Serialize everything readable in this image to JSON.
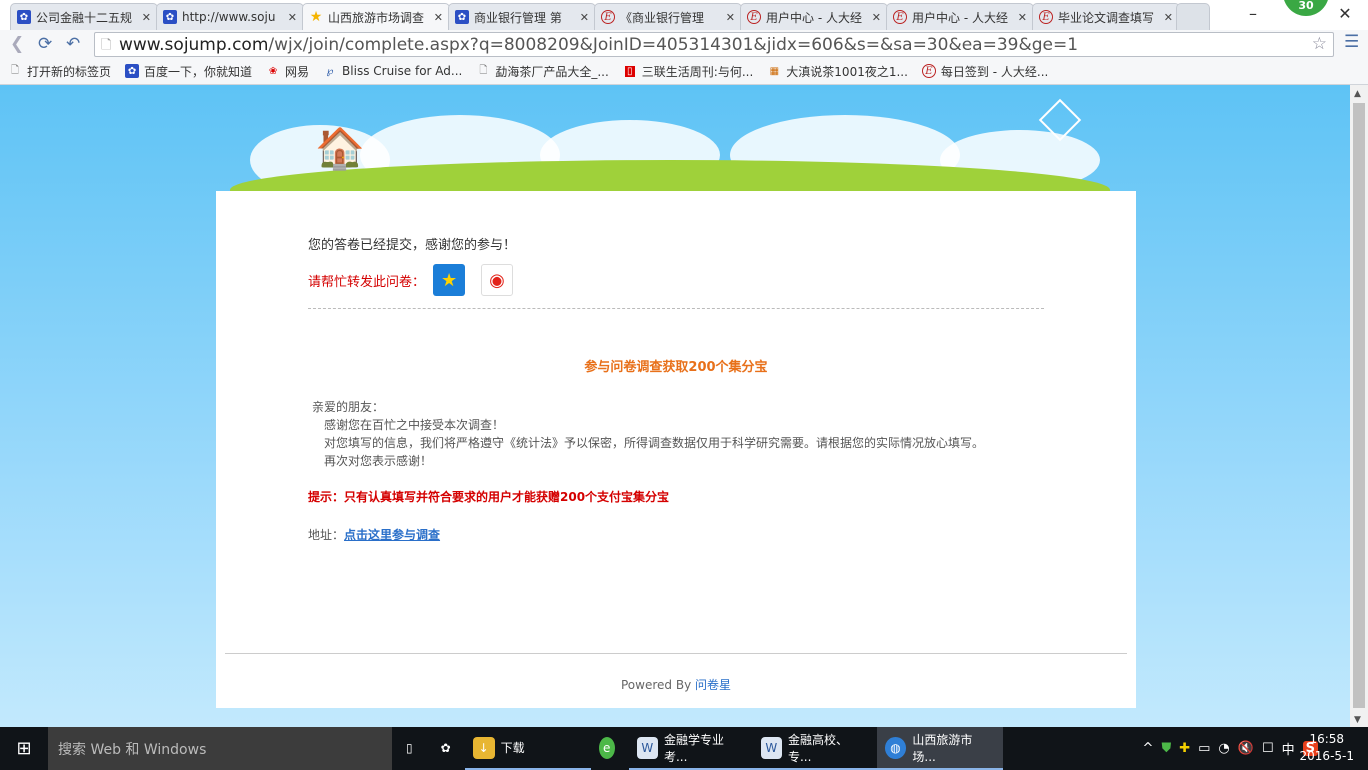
{
  "tabs": [
    {
      "label": "公司金融十二五规",
      "icon": "baidu-paw"
    },
    {
      "label": "http://www.soju",
      "icon": "baidu-paw"
    },
    {
      "label": "山西旅游市场调查",
      "icon": "star",
      "active": true
    },
    {
      "label": "商业银行管理 第",
      "icon": "baidu-paw"
    },
    {
      "label": "《商业银行管理",
      "icon": "e-logo"
    },
    {
      "label": "用户中心 - 人大经",
      "icon": "e-logo"
    },
    {
      "label": "用户中心 - 人大经",
      "icon": "e-logo"
    },
    {
      "label": "毕业论文调查填写",
      "icon": "e-logo"
    }
  ],
  "badge": "30",
  "address": {
    "host": "www.sojump.com",
    "path": "/wjx/join/complete.aspx?q=8008209&JoinID=405314301&jidx=606&s=&sa=30&ea=39&ge=1"
  },
  "bookmarks": [
    {
      "label": "打开新的标签页",
      "icon": "page"
    },
    {
      "label": "百度一下，你就知道",
      "icon": "baidu-paw"
    },
    {
      "label": "网易",
      "icon": "netease"
    },
    {
      "label": "Bliss Cruise for Ad...",
      "icon": "bliss"
    },
    {
      "label": "勐海茶厂产品大全_...",
      "icon": "page"
    },
    {
      "label": "三联生活周刊:与何...",
      "icon": "sanlian"
    },
    {
      "label": "大滇说茶1001夜之1...",
      "icon": "colorful"
    },
    {
      "label": "每日签到 - 人大经...",
      "icon": "e-logo"
    }
  ],
  "content": {
    "submitted": "您的答卷已经提交，感谢您的参与！",
    "share_label": "请帮忙转发此问卷：",
    "promo_title": "参与问卷调查获取200个集分宝",
    "greeting": "亲爱的朋友：",
    "lines": [
      "感谢您在百忙之中接受本次调查！",
      "对您填写的信息，我们将严格遵守《统计法》予以保密，所得调查数据仅用于科学研究需要。请根据您的实际情况放心填写。",
      "再次对您表示感谢！"
    ],
    "tip": "提示：只有认真填写并符合要求的用户才能获赠200个支付宝集分宝",
    "addr_label": "地址：",
    "addr_link": "点击这里参与调查",
    "powered": "Powered By ",
    "powered_link": "问卷星"
  },
  "taskbar": {
    "search": "搜索 Web 和 Windows",
    "apps": [
      {
        "label": "下载"
      },
      {
        "label": ""
      },
      {
        "label": "金融学专业考..."
      },
      {
        "label": "金融高校、专..."
      },
      {
        "label": "山西旅游市场..."
      }
    ],
    "ime": "中",
    "time": "16:58",
    "date": "2016-5-1"
  }
}
